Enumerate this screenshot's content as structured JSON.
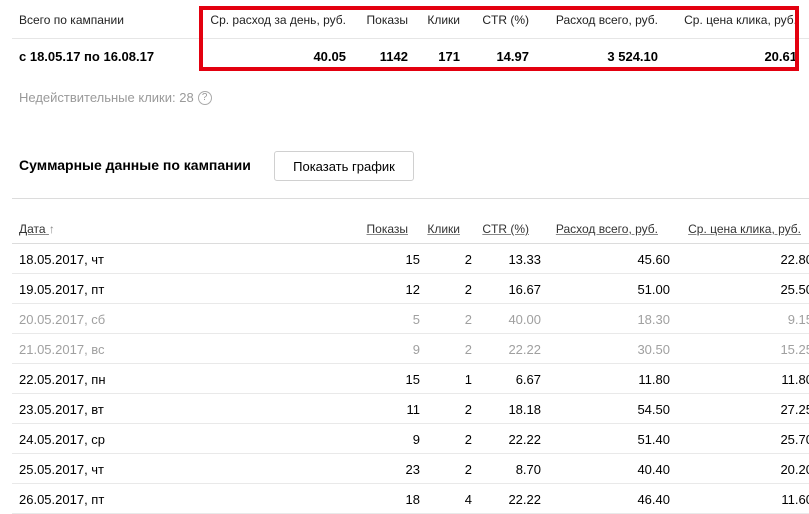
{
  "summary": {
    "headers": {
      "period": "Всего по кампании",
      "avg_daily_spend": "Ср. расход за день, руб.",
      "impressions": "Показы",
      "clicks": "Клики",
      "ctr": "CTR (%)",
      "total_spend": "Расход всего, руб.",
      "avg_cpc": "Ср. цена клика, руб."
    },
    "values": {
      "period": "с 18.05.17 по 16.08.17",
      "avg_daily_spend": "40.05",
      "impressions": "1142",
      "clicks": "171",
      "ctr": "14.97",
      "total_spend": "3 524.10",
      "avg_cpc": "20.61"
    },
    "highlight_color": "#e3000f"
  },
  "invalid_clicks": {
    "label": "Недействительные клики: 28",
    "help_icon": "?"
  },
  "section": {
    "title": "Суммарные данные по кампании",
    "button_label": "Показать график"
  },
  "table": {
    "headers": {
      "date": "Дата",
      "sort_arrow": "↑",
      "impressions": "Показы",
      "clicks": "Клики",
      "ctr": "CTR (%)",
      "total_spend": "Расход всего, руб.",
      "avg_cpc": "Ср. цена клика, руб."
    },
    "rows": [
      {
        "date": "18.05.2017, чт",
        "impressions": "15",
        "clicks": "2",
        "ctr": "13.33",
        "spend": "45.60",
        "cpc": "22.80",
        "muted": false
      },
      {
        "date": "19.05.2017, пт",
        "impressions": "12",
        "clicks": "2",
        "ctr": "16.67",
        "spend": "51.00",
        "cpc": "25.50",
        "muted": false
      },
      {
        "date": "20.05.2017, сб",
        "impressions": "5",
        "clicks": "2",
        "ctr": "40.00",
        "spend": "18.30",
        "cpc": "9.15",
        "muted": true
      },
      {
        "date": "21.05.2017, вс",
        "impressions": "9",
        "clicks": "2",
        "ctr": "22.22",
        "spend": "30.50",
        "cpc": "15.25",
        "muted": true
      },
      {
        "date": "22.05.2017, пн",
        "impressions": "15",
        "clicks": "1",
        "ctr": "6.67",
        "spend": "11.80",
        "cpc": "11.80",
        "muted": false
      },
      {
        "date": "23.05.2017, вт",
        "impressions": "11",
        "clicks": "2",
        "ctr": "18.18",
        "spend": "54.50",
        "cpc": "27.25",
        "muted": false
      },
      {
        "date": "24.05.2017, ср",
        "impressions": "9",
        "clicks": "2",
        "ctr": "22.22",
        "spend": "51.40",
        "cpc": "25.70",
        "muted": false
      },
      {
        "date": "25.05.2017, чт",
        "impressions": "23",
        "clicks": "2",
        "ctr": "8.70",
        "spend": "40.40",
        "cpc": "20.20",
        "muted": false
      },
      {
        "date": "26.05.2017, пт",
        "impressions": "18",
        "clicks": "4",
        "ctr": "22.22",
        "spend": "46.40",
        "cpc": "11.60",
        "muted": false
      }
    ]
  }
}
